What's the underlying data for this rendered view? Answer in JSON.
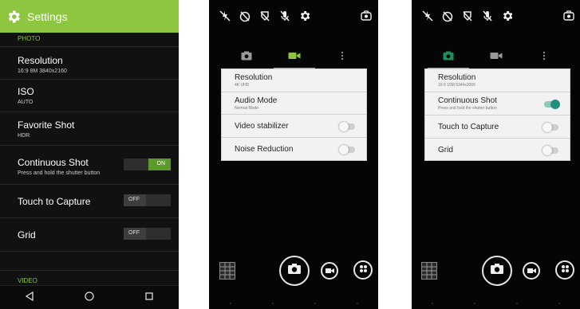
{
  "settings": {
    "title": "Settings",
    "category_photo": "PHOTO",
    "category_video": "VIDEO",
    "items": [
      {
        "title": "Resolution",
        "subtitle": "16:9 8M 3840x2160"
      },
      {
        "title": "ISO",
        "subtitle": "AUTO"
      },
      {
        "title": "Favorite Shot",
        "subtitle": "HDR"
      },
      {
        "title": "Continuous Shot",
        "subtitle": "Press and hold the shutter button",
        "switch": "ON"
      },
      {
        "title": "Touch to Capture",
        "switch": "OFF"
      },
      {
        "title": "Grid",
        "switch": "OFF"
      }
    ],
    "nav_icons": [
      "back-icon",
      "home-icon",
      "recents-icon"
    ],
    "accent": "#8ec63f"
  },
  "video_panel": {
    "items": [
      {
        "title": "Resolution",
        "subtitle": "4K UHD"
      },
      {
        "title": "Audio Mode",
        "subtitle": "Normal Mode"
      },
      {
        "title": "Video stabilizer",
        "toggle": false
      },
      {
        "title": "Noise Reduction",
        "toggle": false
      }
    ]
  },
  "photo_panel": {
    "items": [
      {
        "title": "Resolution",
        "subtitle": "16:9 15M 5344x3006"
      },
      {
        "title": "Continuous Shot",
        "subtitle": "Press and hold the shutter button",
        "toggle": true
      },
      {
        "title": "Touch to Capture",
        "toggle": false
      },
      {
        "title": "Grid",
        "toggle": false
      }
    ]
  },
  "camera_icons": {
    "top": [
      "flash-off-icon",
      "timer-off-icon",
      "hdr-off-icon",
      "mic-off-icon",
      "settings-gear-icon",
      "switch-camera-icon"
    ],
    "tabs": [
      "photo-camera-icon",
      "video-camera-icon",
      "more-vert-icon"
    ],
    "bottom": [
      "gallery-thumbnail",
      "shutter-icon",
      "video-record-icon",
      "modes-icon"
    ]
  },
  "colors": {
    "accent": "#8ec63f",
    "toggle_on": "#21907a"
  }
}
